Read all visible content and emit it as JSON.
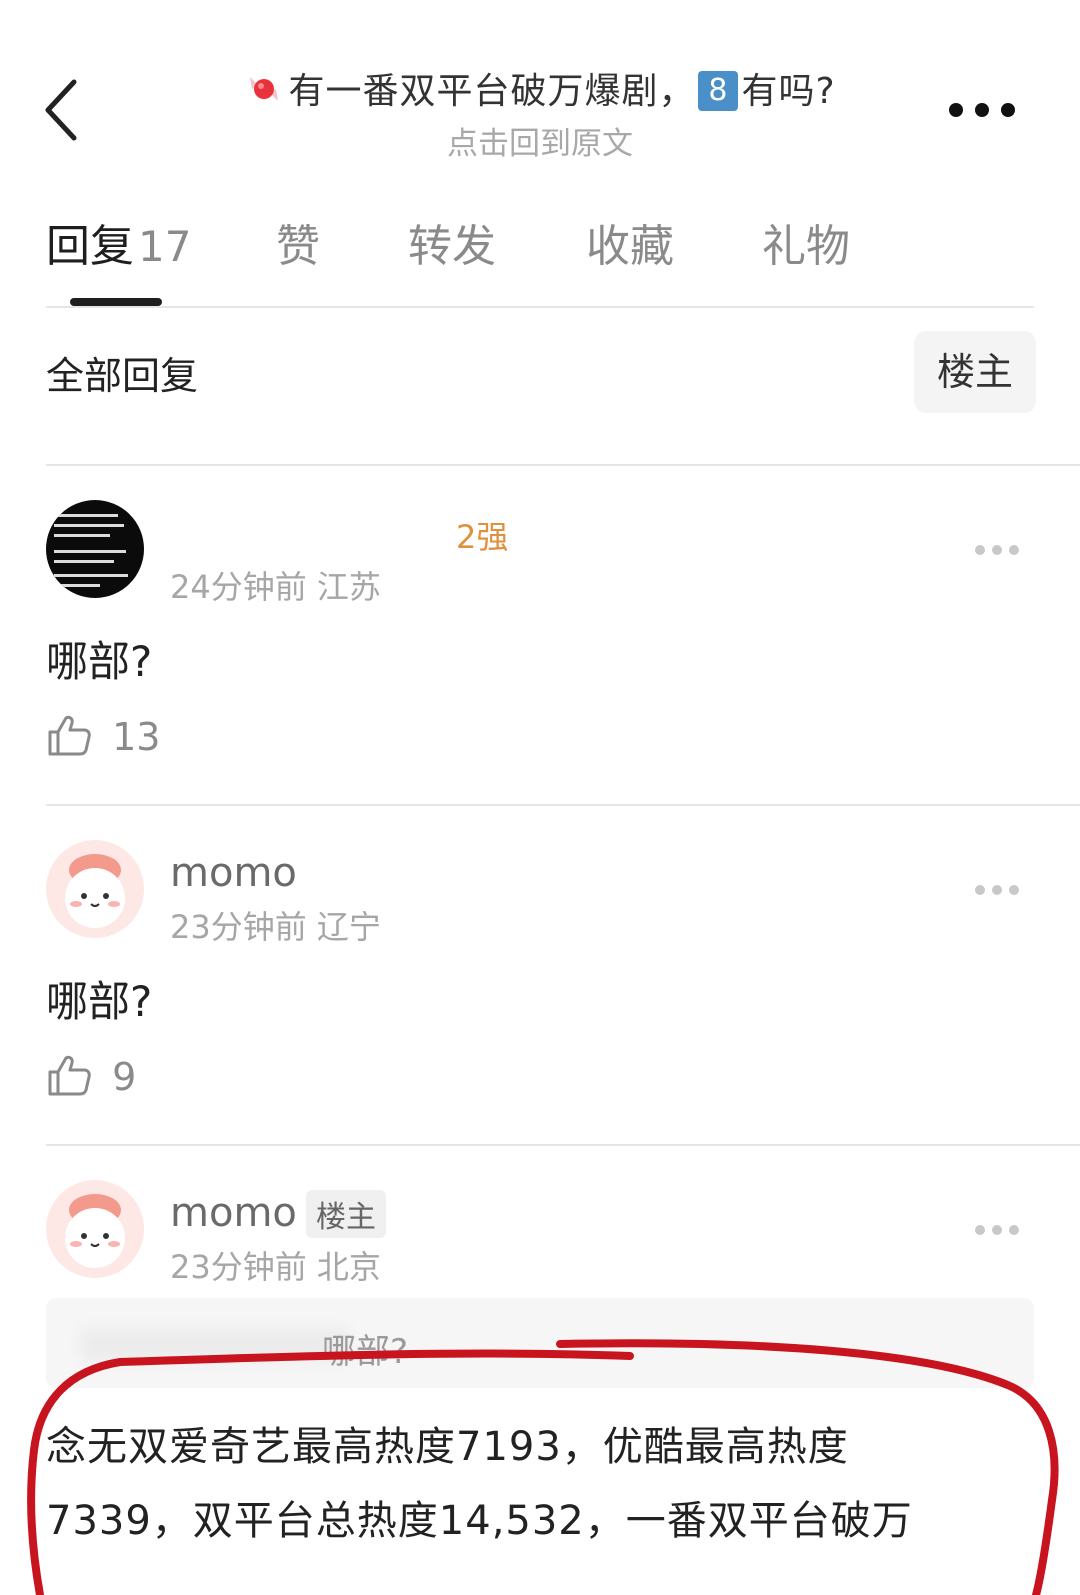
{
  "header": {
    "back_icon": "chevron-left-icon",
    "title_prefix_icon": "candy-icon",
    "title_part1": "有一番双平台破万爆剧，",
    "title_badge": "8",
    "title_part2": "有吗?",
    "subtitle": "点击回到原文",
    "more_icon": "more-horizontal-icon"
  },
  "tabs": [
    {
      "label": "回复",
      "count": "17",
      "active": true
    },
    {
      "label": "赞"
    },
    {
      "label": "转发"
    },
    {
      "label": "收藏"
    },
    {
      "label": "礼物"
    }
  ],
  "filter": {
    "all_label": "全部回复",
    "op_label": "楼主"
  },
  "comments": [
    {
      "username": "",
      "level_badge": "2强",
      "time": "24分钟前",
      "location": "江苏",
      "text": "哪部?",
      "likes": "13"
    },
    {
      "username": "momo",
      "time": "23分钟前",
      "location": "辽宁",
      "text": "哪部?",
      "likes": "9"
    },
    {
      "username": "momo",
      "op_tag": "楼主",
      "time": "23分钟前",
      "location": "北京",
      "quote_text": "哪部?",
      "answer_line1": "念无双爱奇艺最高热度7193，优酷最高热度",
      "answer_line2": "7339，双平台总热度14,532，一番双平台破万"
    }
  ],
  "colors": {
    "annotation_circle": "#c8141e",
    "level_badge": "#e1903e",
    "tab_indicator": "#1e1e1e"
  }
}
